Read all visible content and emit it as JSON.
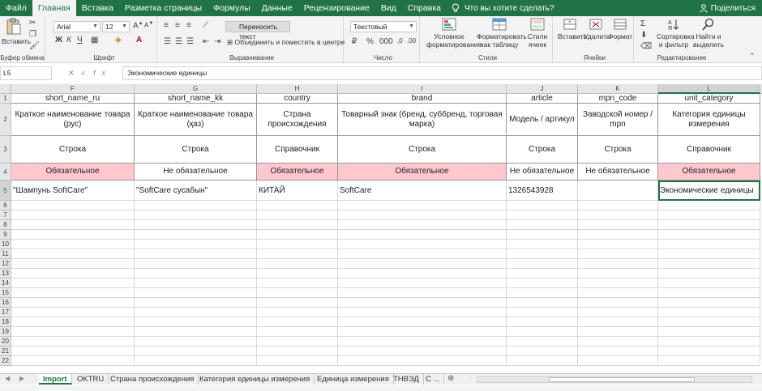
{
  "ribbon_tabs": [
    "Файл",
    "Главная",
    "Вставка",
    "Разметка страницы",
    "Формулы",
    "Данные",
    "Рецензирование",
    "Вид",
    "Справка"
  ],
  "tell_me": "Что вы хотите сделать?",
  "share": "Поделиться",
  "ribbon": {
    "paste": "Вставить",
    "clipboard_group": "Буфер обмена",
    "font_name": "Arial",
    "font_size": "12",
    "bold": "Ж",
    "italic": "К",
    "underline": "Ч",
    "font_group": "Шрифт",
    "wrap_text": "Переносить текст",
    "merge_center": "Объединить и поместить в центре",
    "alignment_group": "Выравнивание",
    "number_format": "Текстовый",
    "number_group": "Число",
    "conditional_formatting": "Условное форматирование",
    "format_as_table": "Форматировать как таблицу",
    "cell_styles": "Стили ячеек",
    "styles_group": "Стили",
    "insert": "Вставить",
    "delete": "Удалить",
    "format": "Формат",
    "cells_group": "Ячейки",
    "sort_filter": "Сортировка и фильтр",
    "find_select": "Найти и выделить",
    "editing_group": "Редактирование"
  },
  "formula_bar": {
    "name_box": "L5",
    "fx": "fx",
    "content": "Экономические единицы"
  },
  "columns": [
    "F",
    "G",
    "H",
    "I",
    "J",
    "K",
    "L"
  ],
  "row_numbers": [
    "1",
    "2",
    "3",
    "4",
    "5",
    "6",
    "7",
    "8",
    "9",
    "10",
    "11",
    "12",
    "13",
    "14",
    "15",
    "16",
    "17",
    "18",
    "19",
    "20",
    "21",
    "22"
  ],
  "sheet_rows": {
    "row1": [
      "short_name_ru",
      "short_name_kk",
      "country",
      "brand",
      "article",
      "mpn_code",
      "unit_category"
    ],
    "row2": [
      "Краткое наименование товара (рус)",
      "Краткое наименование товара (қаз)",
      "Страна происхождения",
      "Товарный знак (бренд, суббренд, торговая марка)",
      "Модель / артикул",
      "Заводской номер / mpn",
      "Категория единицы измерения"
    ],
    "row3": [
      "Строка",
      "Строка",
      "Справочник",
      "Строка",
      "Строка",
      "Строка",
      "Справочник"
    ],
    "row4": [
      "Обязательное",
      "Не обязательное",
      "Обязательное",
      "Обязательное",
      "Не обязательное",
      "Не обязательное",
      "Обязательное"
    ],
    "row5": [
      "\"Шампунь SoftCare\"",
      "\"SoftCare сусабын\"",
      "КИТАЙ",
      "SoftCare",
      "1326543928",
      "",
      "Экономические единицы"
    ]
  },
  "required_flags": [
    true,
    false,
    true,
    true,
    false,
    false,
    true
  ],
  "sheet_tabs": [
    "Import",
    "OKTRU",
    "Страна происхождения",
    "Категория единицы измерения",
    "Единица измерения",
    "ТНВЭД",
    "С ..."
  ],
  "active_sheet": "Import",
  "colors": {
    "accent": "#217346",
    "required_fill": "#ffc7ce"
  }
}
